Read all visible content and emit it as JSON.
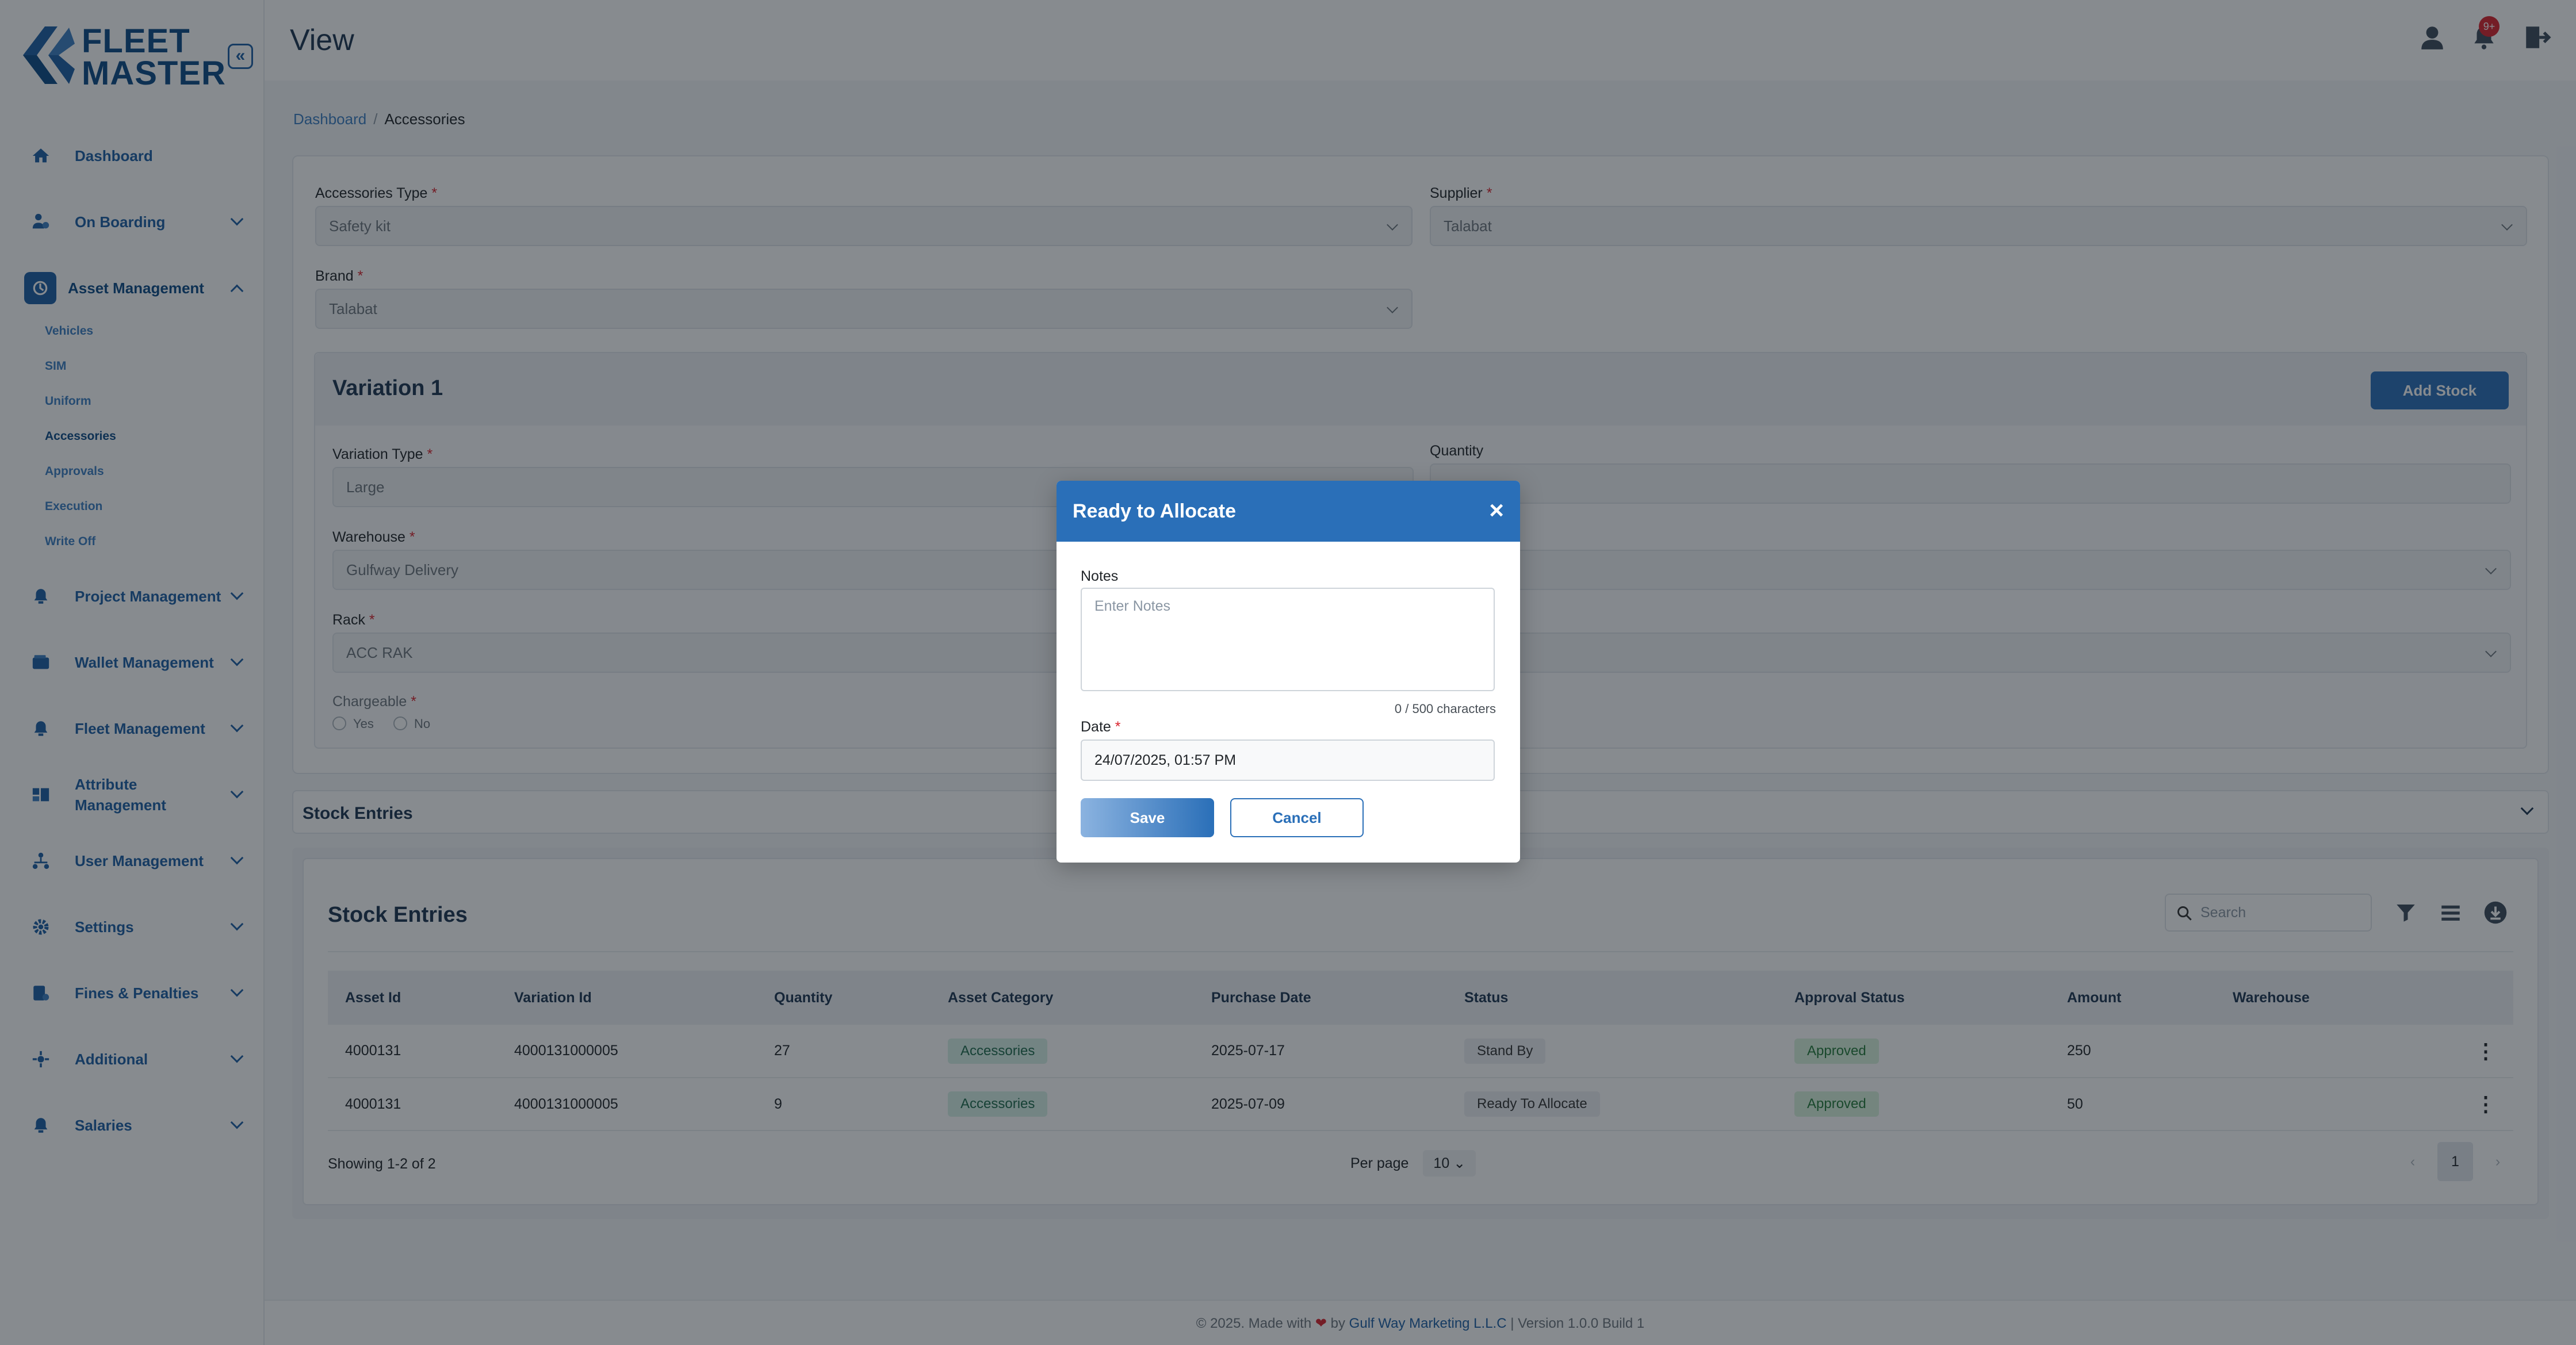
{
  "brand": {
    "line1": "FLEET",
    "line2": "MASTER",
    "color": "#0c4a86"
  },
  "header": {
    "title": "View",
    "notification_count": "9+"
  },
  "sidebar": {
    "collapse_glyph": "«",
    "items": [
      {
        "label": "Dashboard",
        "icon": "home-icon"
      },
      {
        "label": "On Boarding",
        "icon": "onboarding-icon"
      },
      {
        "label": "Asset Management",
        "icon": "asset-icon"
      },
      {
        "label": "Project Management",
        "icon": "project-icon"
      },
      {
        "label": "Wallet Management",
        "icon": "wallet-icon"
      },
      {
        "label": "Fleet Management",
        "icon": "fleet-icon"
      },
      {
        "label": "Attribute Management",
        "icon": "attribute-icon"
      },
      {
        "label": "User Management",
        "icon": "users-icon"
      },
      {
        "label": "Settings",
        "icon": "gear-icon"
      },
      {
        "label": "Fines & Penalties",
        "icon": "fines-icon"
      },
      {
        "label": "Additional",
        "icon": "additional-icon"
      },
      {
        "label": "Salaries",
        "icon": "salaries-icon"
      }
    ],
    "asset_sub": [
      "Vehicles",
      "SIM",
      "Uniform",
      "Accessories",
      "Approvals",
      "Execution",
      "Write Off"
    ]
  },
  "breadcrumb": {
    "root": "Dashboard",
    "current": "Accessories"
  },
  "form": {
    "accessories_type_label": "Accessories Type",
    "accessories_type_value": "Safety kit",
    "supplier_label": "Supplier",
    "supplier_value": "Talabat",
    "brand_label": "Brand",
    "brand_value": "Talabat",
    "required_mark": "*"
  },
  "variation": {
    "title": "Variation 1",
    "add_stock_label": "Add Stock",
    "type_label": "Variation Type",
    "type_value": "Large",
    "quantity_label": "Quantity",
    "warehouse_label": "Warehouse",
    "warehouse_value": "Gulfway Delivery",
    "rack_label": "Rack",
    "rack_value": "ACC RAK",
    "chargeable_label": "Chargeable",
    "yes_label": "Yes",
    "no_label": "No"
  },
  "accordion": {
    "title": "Stock Entries"
  },
  "stock": {
    "title": "Stock Entries",
    "search_placeholder": "Search",
    "columns": [
      "Asset Id",
      "Variation Id",
      "Quantity",
      "Asset Category",
      "Purchase Date",
      "Status",
      "Approval Status",
      "Amount",
      "Warehouse"
    ],
    "rows": [
      {
        "asset_id": "4000131",
        "variation_id": "4000131000005",
        "quantity": "27",
        "category": "Accessories",
        "purchase_date": "2025-07-17",
        "status": "Stand By",
        "approval": "Approved",
        "amount": "250",
        "warehouse": ""
      },
      {
        "asset_id": "4000131",
        "variation_id": "4000131000005",
        "quantity": "9",
        "category": "Accessories",
        "purchase_date": "2025-07-09",
        "status": "Ready To Allocate",
        "approval": "Approved",
        "amount": "50",
        "warehouse": ""
      }
    ],
    "showing": "Showing 1-2 of 2",
    "per_page_label": "Per page",
    "per_page_value": "10",
    "current_page": "1",
    "prev_glyph": "‹",
    "next_glyph": "›",
    "kebab_glyph": "⋮"
  },
  "footer": {
    "prefix": "© 2025. Made with",
    "heart": "❤",
    "by": "by",
    "company": "Gulf Way Marketing L.L.C",
    "suffix": "| Version 1.0.0 Build 1"
  },
  "modal": {
    "title": "Ready to Allocate",
    "close_glyph": "×",
    "notes_label": "Notes",
    "notes_placeholder": "Enter Notes",
    "char_count": "0 / 500 characters",
    "date_label": "Date",
    "date_value": "24/07/2025, 01:57 PM",
    "save_label": "Save",
    "cancel_label": "Cancel"
  },
  "colors": {
    "primary": "#2a6fb8",
    "required": "#d9232d",
    "approved": "#247a3a"
  }
}
